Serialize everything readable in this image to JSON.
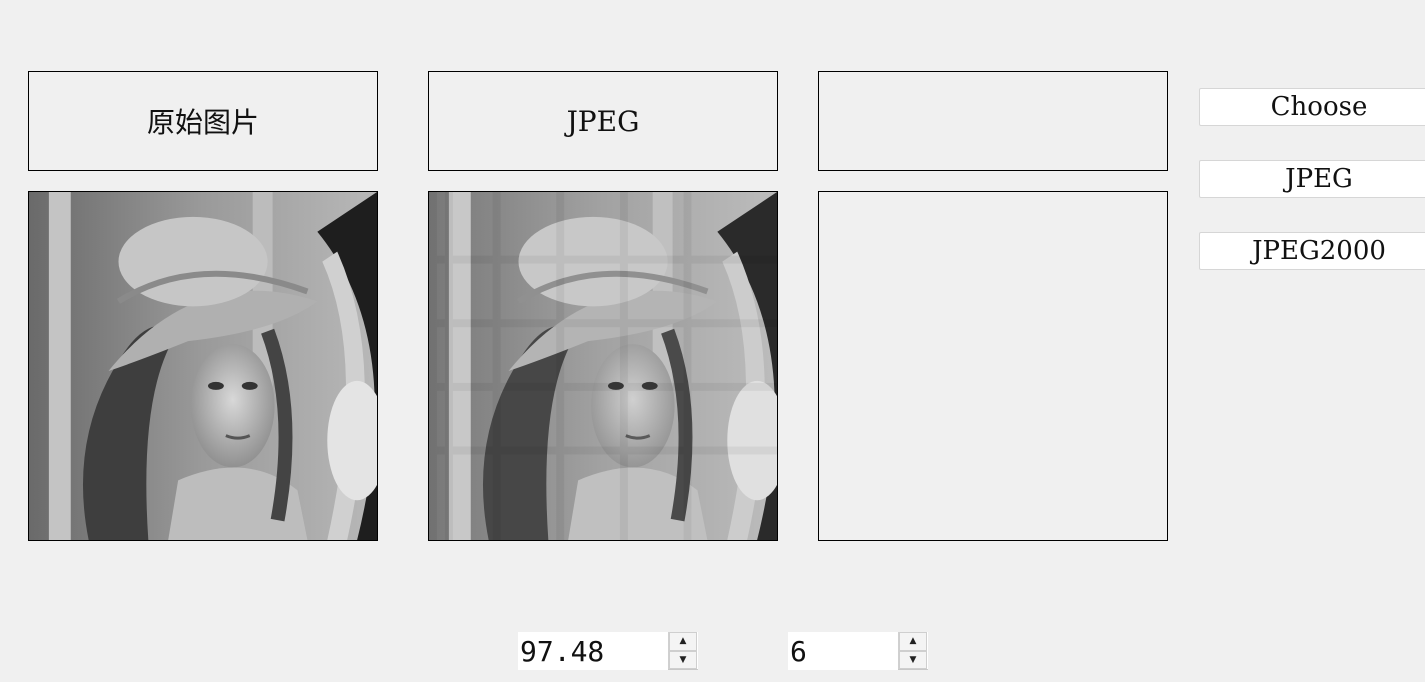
{
  "labels": {
    "original": "原始图片",
    "jpeg": "JPEG",
    "third": ""
  },
  "buttons": {
    "choose": "Choose",
    "jpeg": "JPEG",
    "jpeg2000": "JPEG2000"
  },
  "spinboxes": {
    "first_value": "97.48",
    "second_value": "6"
  },
  "icons": {
    "spin_up": "▲",
    "spin_down": "▼"
  }
}
